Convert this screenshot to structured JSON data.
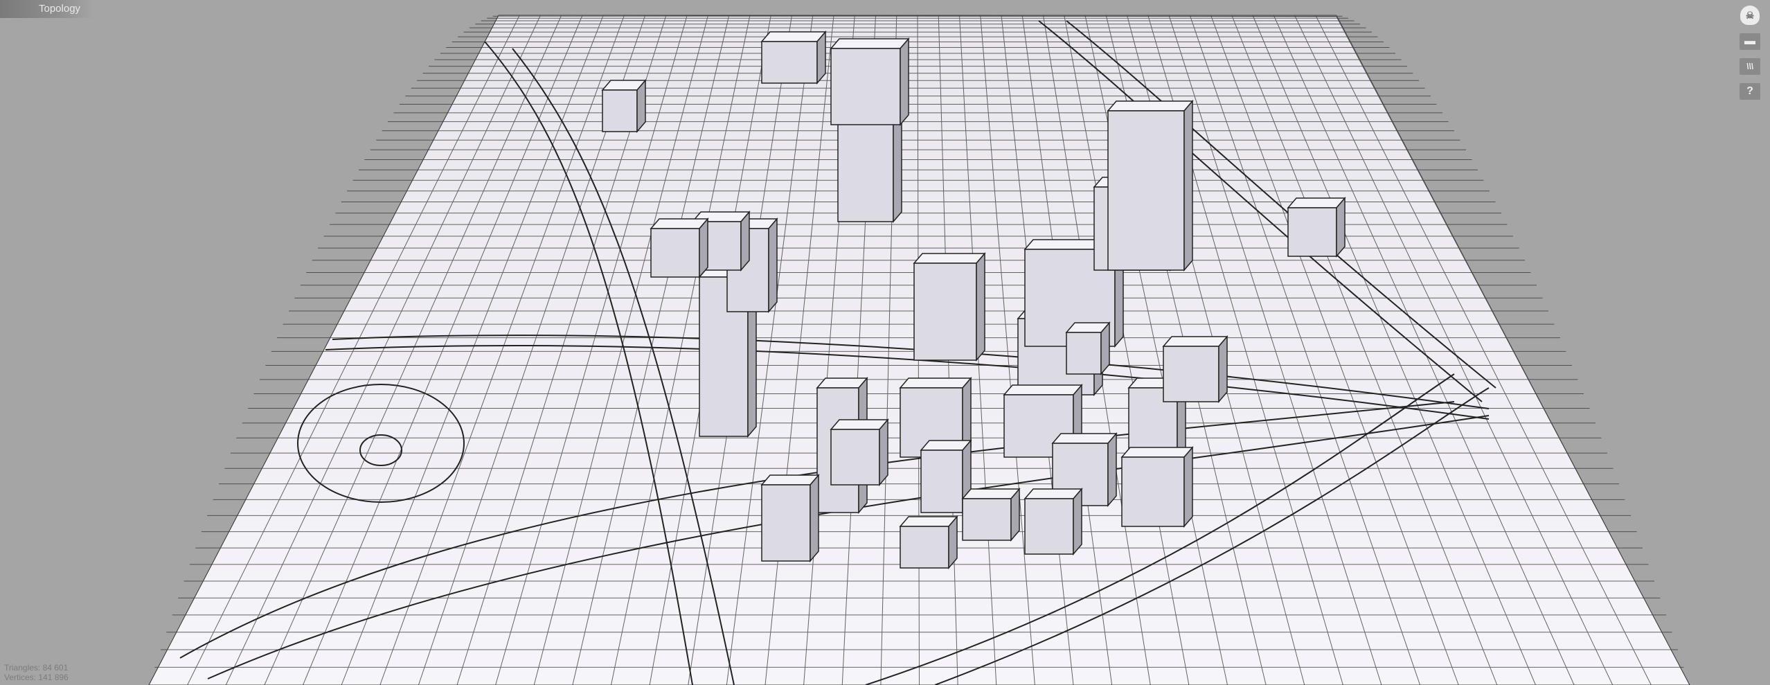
{
  "header": {
    "title": "Topology"
  },
  "stats": {
    "triangles": "Triangles: 84 601",
    "vertices": "Vertices: 141 896"
  },
  "toolbar": {
    "items": [
      {
        "icon": "skull-icon",
        "glyph": "☠"
      },
      {
        "icon": "solid-view-icon",
        "glyph": "▬"
      },
      {
        "icon": "wireframe-icon",
        "glyph": "\\\\\\"
      },
      {
        "icon": "help-icon",
        "glyph": "?"
      }
    ]
  },
  "colors": {
    "background": "#a5a5a5",
    "mesh": "#f2f0f6",
    "lines": "#2a2a2a"
  }
}
